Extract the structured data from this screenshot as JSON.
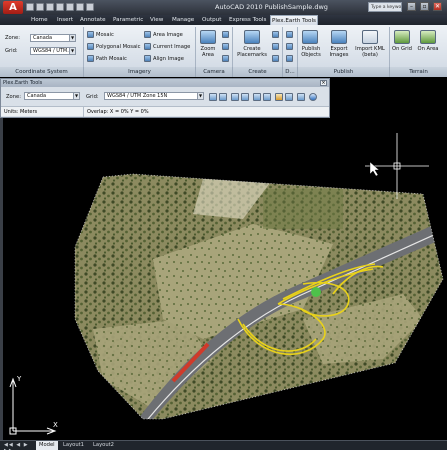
{
  "app": {
    "logo": "A",
    "title": "AutoCAD 2010    PublishSample.dwg",
    "search_placeholder": "Type a keyword",
    "window_controls": [
      "–",
      "▫",
      "✕"
    ]
  },
  "ribbon": {
    "tabs": [
      {
        "label": "Home"
      },
      {
        "label": "Insert"
      },
      {
        "label": "Annotate"
      },
      {
        "label": "Parametric"
      },
      {
        "label": "View"
      },
      {
        "label": "Manage"
      },
      {
        "label": "Output"
      },
      {
        "label": "Express Tools"
      },
      {
        "label": "Plex.Earth Tools"
      }
    ],
    "active_tab": "Plex.Earth Tools",
    "coordinate_system": {
      "zone_label": "Zone:",
      "zone_value": "Canada",
      "grid_label": "Grid:",
      "grid_value": "WGS84 / UTM...",
      "panel_title": "Coordinate System"
    },
    "imagery": {
      "buttons": [
        "Mosaic",
        "Polygonal Mosaic",
        "Path Mosaic",
        "Area Image",
        "Current Image",
        "Align Image"
      ],
      "panel_title": "Imagery"
    },
    "camera": {
      "button": "Zoom Area",
      "panel_title": "Camera"
    },
    "create": {
      "button": "Create Placemarks",
      "panel_title": "Create"
    },
    "d": {
      "panel_title": "D..."
    },
    "publish": {
      "buttons": [
        "Publish Objects",
        "Export Images",
        "Import KML (beta)"
      ],
      "panel_title": "Publish"
    },
    "terrain": {
      "buttons": [
        "On Grid",
        "On Area"
      ],
      "panel_title": "Terrain"
    }
  },
  "toolbar": {
    "caption": "Plex.Earth Tools",
    "zone_label": "Zone:",
    "zone_value": "Canada",
    "grid_label": "Grid:",
    "grid_value": "WGS84 / UTM Zone 15N",
    "units": "Units: Meters",
    "overlap": "Overlap:  X = 0%   Y = 0%"
  },
  "layout_tabs": [
    {
      "label": "Model",
      "active": true
    },
    {
      "label": "Layout1",
      "active": false
    },
    {
      "label": "Layout2",
      "active": false
    }
  ],
  "colors": {
    "app_red": "#c8291c",
    "ribbon_bg": "#dfe6ee",
    "drawing_bg": "#000000",
    "road_yellow": "#e9d21a"
  }
}
